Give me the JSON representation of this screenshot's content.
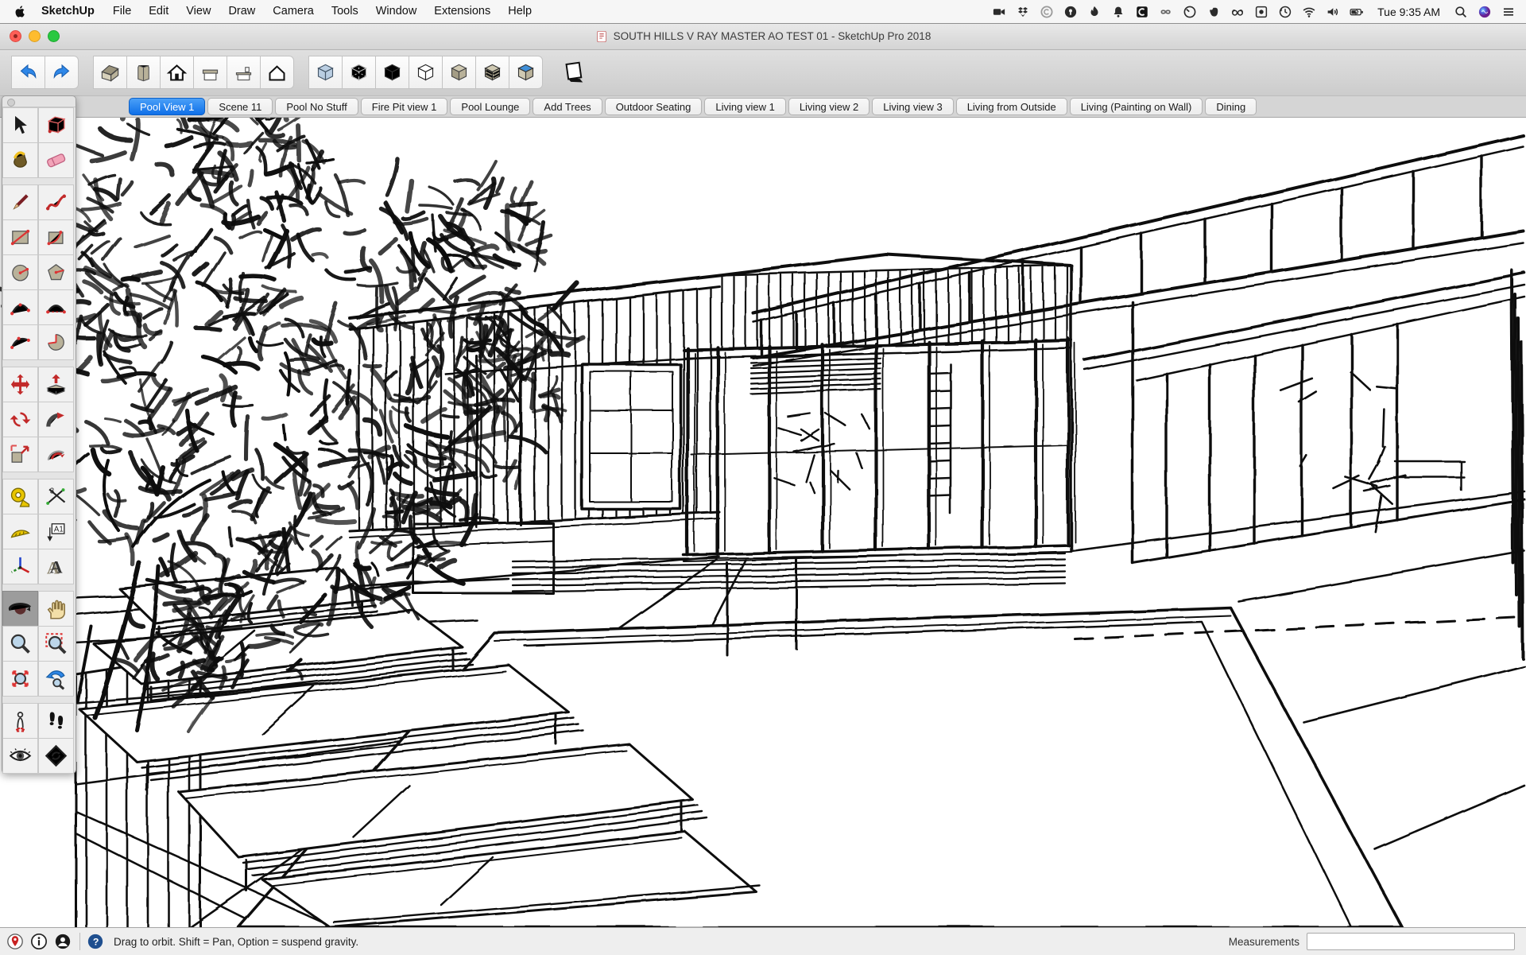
{
  "menu_bar": {
    "app_name": "SketchUp",
    "menus": [
      "File",
      "Edit",
      "View",
      "Draw",
      "Camera",
      "Tools",
      "Window",
      "Extensions",
      "Help"
    ],
    "status_icons": [
      "video-camera-icon",
      "dropbox-icon",
      "creative-cloud-icon",
      "onepassword-icon",
      "flame-icon",
      "notification-bell-icon",
      "c-app-icon",
      "infinity-icon",
      "circle-app-icon",
      "evernote-icon",
      "glasses-icon",
      "screen-recording-icon",
      "time-machine-icon",
      "wifi-icon",
      "volume-icon",
      "battery-charging-icon"
    ],
    "clock": "Tue 9:35 AM",
    "right_tools": [
      "spotlight-search-icon",
      "siri-icon",
      "notification-center-icon"
    ]
  },
  "window": {
    "title": "SOUTH HILLS V RAY MASTER AO TEST 01 - SketchUp Pro 2018"
  },
  "toolbar": {
    "history": [
      {
        "id": "undo-button",
        "name": "Undo",
        "icon": "undo-icon"
      },
      {
        "id": "redo-button",
        "name": "Redo",
        "icon": "redo-icon"
      }
    ],
    "views": [
      {
        "id": "view-iso",
        "name": "Iso",
        "icon": "iso-view-icon"
      },
      {
        "id": "view-top",
        "name": "Top",
        "icon": "top-view-icon"
      },
      {
        "id": "view-front",
        "name": "Front",
        "icon": "front-view-icon"
      },
      {
        "id": "view-back",
        "name": "Back",
        "icon": "back-view-icon"
      },
      {
        "id": "view-left",
        "name": "Left",
        "icon": "left-view-icon"
      },
      {
        "id": "view-right",
        "name": "Right",
        "icon": "right-view-icon"
      }
    ],
    "face_styles": [
      {
        "id": "style-xray",
        "name": "X-Ray",
        "icon": "xray-cube-icon"
      },
      {
        "id": "style-back-edges",
        "name": "Back Edges",
        "icon": "back-edges-cube-icon"
      },
      {
        "id": "style-wireframe",
        "name": "Wireframe",
        "icon": "wireframe-cube-icon"
      },
      {
        "id": "style-hidden-line",
        "name": "Hidden Line",
        "icon": "hidden-line-cube-icon"
      },
      {
        "id": "style-shaded",
        "name": "Shaded",
        "icon": "shaded-cube-icon"
      },
      {
        "id": "style-shaded-textures",
        "name": "Shaded With Textures",
        "icon": "textured-cube-icon"
      },
      {
        "id": "style-monochrome",
        "name": "Monochrome",
        "icon": "monochrome-cube-icon"
      }
    ],
    "extras": [
      {
        "id": "shadows-toggle",
        "name": "Shadows",
        "icon": "shadows-icon"
      }
    ]
  },
  "scene_tabs": {
    "tabs": [
      {
        "label": "Pool View 1",
        "active": true
      },
      {
        "label": "Scene 11"
      },
      {
        "label": "Pool No Stuff"
      },
      {
        "label": "Fire Pit view 1"
      },
      {
        "label": "Pool Lounge"
      },
      {
        "label": "Add Trees"
      },
      {
        "label": "Outdoor Seating"
      },
      {
        "label": "Living view 1"
      },
      {
        "label": "Living view 2"
      },
      {
        "label": "Living view 3"
      },
      {
        "label": "Living from Outside"
      },
      {
        "label": "Living (Painting on Wall)"
      },
      {
        "label": "Dining"
      }
    ]
  },
  "tool_palette": {
    "groups": [
      {
        "tools": [
          {
            "id": "tool-select",
            "name": "Select",
            "icon": "select-cursor-icon"
          },
          {
            "id": "tool-make-component",
            "name": "Make Component",
            "icon": "make-component-icon"
          },
          {
            "id": "tool-paint-bucket",
            "name": "Paint Bucket",
            "icon": "paint-bucket-icon"
          },
          {
            "id": "tool-eraser",
            "name": "Eraser",
            "icon": "eraser-icon"
          }
        ]
      },
      {
        "tools": [
          {
            "id": "tool-line",
            "name": "Line",
            "icon": "line-pencil-icon"
          },
          {
            "id": "tool-freehand",
            "name": "Freehand",
            "icon": "freehand-icon"
          },
          {
            "id": "tool-rectangle",
            "name": "Rectangle",
            "icon": "rectangle-icon"
          },
          {
            "id": "tool-rotated-rectangle",
            "name": "Rotated Rectangle",
            "icon": "rotated-rectangle-icon"
          },
          {
            "id": "tool-circle",
            "name": "Circle",
            "icon": "circle-icon"
          },
          {
            "id": "tool-polygon",
            "name": "Polygon",
            "icon": "polygon-icon"
          },
          {
            "id": "tool-arc",
            "name": "Arc",
            "icon": "arc-icon"
          },
          {
            "id": "tool-2pt-arc",
            "name": "2 Point Arc",
            "icon": "two-point-arc-icon"
          },
          {
            "id": "tool-3pt-arc",
            "name": "3 Point Arc",
            "icon": "three-point-arc-icon"
          },
          {
            "id": "tool-pie",
            "name": "Pie",
            "icon": "pie-icon"
          }
        ]
      },
      {
        "tools": [
          {
            "id": "tool-move",
            "name": "Move",
            "icon": "move-icon"
          },
          {
            "id": "tool-push-pull",
            "name": "Push/Pull",
            "icon": "push-pull-icon"
          },
          {
            "id": "tool-rotate",
            "name": "Rotate",
            "icon": "rotate-icon"
          },
          {
            "id": "tool-follow-me",
            "name": "Follow Me",
            "icon": "follow-me-icon"
          },
          {
            "id": "tool-scale",
            "name": "Scale",
            "icon": "scale-icon"
          },
          {
            "id": "tool-offset",
            "name": "Offset",
            "icon": "offset-icon"
          }
        ]
      },
      {
        "tools": [
          {
            "id": "tool-tape-measure",
            "name": "Tape Measure",
            "icon": "tape-measure-icon"
          },
          {
            "id": "tool-dimensions",
            "name": "Dimensions",
            "icon": "dimensions-icon"
          },
          {
            "id": "tool-protractor",
            "name": "Protractor",
            "icon": "protractor-icon"
          },
          {
            "id": "tool-text",
            "name": "Text",
            "icon": "text-icon"
          },
          {
            "id": "tool-axes",
            "name": "Axes",
            "icon": "axes-icon"
          },
          {
            "id": "tool-3d-text",
            "name": "3D Text",
            "icon": "threed-text-icon"
          }
        ]
      },
      {
        "tools": [
          {
            "id": "tool-orbit",
            "name": "Orbit",
            "icon": "orbit-icon",
            "active": true
          },
          {
            "id": "tool-pan",
            "name": "Pan",
            "icon": "pan-icon"
          },
          {
            "id": "tool-zoom",
            "name": "Zoom",
            "icon": "zoom-icon"
          },
          {
            "id": "tool-zoom-window",
            "name": "Zoom Window",
            "icon": "zoom-window-icon"
          },
          {
            "id": "tool-zoom-extents",
            "name": "Zoom Extents",
            "icon": "zoom-extents-icon"
          },
          {
            "id": "tool-previous",
            "name": "Previous",
            "icon": "previous-icon"
          }
        ]
      },
      {
        "tools": [
          {
            "id": "tool-position-camera",
            "name": "Position Camera",
            "icon": "position-camera-icon"
          },
          {
            "id": "tool-walk",
            "name": "Walk",
            "icon": "walk-icon"
          },
          {
            "id": "tool-look-around",
            "name": "Look Around",
            "icon": "look-around-icon"
          },
          {
            "id": "tool-section-plane",
            "name": "Section Plane",
            "icon": "section-plane-icon"
          }
        ]
      }
    ]
  },
  "status_bar": {
    "icons_a": [
      "geolocation-icon",
      "model-info-icon",
      "credits-user-icon"
    ],
    "icons_b": [
      "help-icon"
    ],
    "hint": "Drag to orbit. Shift = Pan, Option = suspend gravity.",
    "measurements_label": "Measurements",
    "measurements_value": ""
  }
}
